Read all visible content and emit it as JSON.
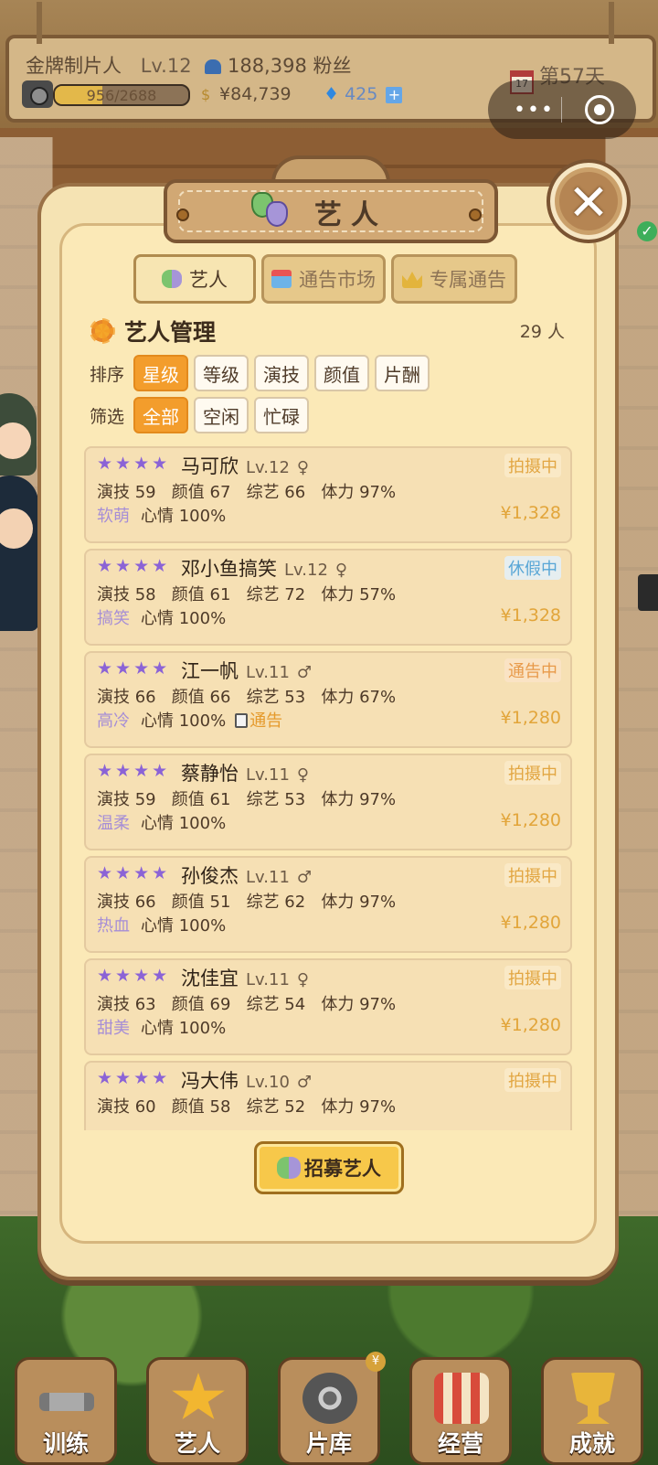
{
  "hud": {
    "title": "金牌制片人",
    "level": "Lv.12",
    "fans": "188,398 粉丝",
    "xp_text": "956/2688",
    "xp_fraction": 0.356,
    "money": "¥84,739",
    "gems": "425",
    "day": "第57天",
    "calendar_day": "17"
  },
  "panel": {
    "title": "艺人",
    "tabs": [
      {
        "label": "艺人",
        "icon": "masks-icon"
      },
      {
        "label": "通告市场",
        "icon": "market-icon"
      },
      {
        "label": "专属通告",
        "icon": "crown-icon"
      }
    ],
    "section_title": "艺人管理",
    "count": "29 人",
    "sort_label": "排序",
    "sort_options": [
      "星级",
      "等级",
      "演技",
      "颜值",
      "片酬"
    ],
    "filter_label": "筛选",
    "filter_options": [
      "全部",
      "空闲",
      "忙碌"
    ],
    "recruit_label": "招募艺人"
  },
  "artists": [
    {
      "stars": "★★★★",
      "name": "马可欣",
      "level": "Lv.12",
      "gender": "♀",
      "status": "拍摄中",
      "stats": "演技 59   颜值 67   综艺 66   体力 97%",
      "trait": "软萌",
      "mood": "心情 100%",
      "tag": "",
      "pay": "¥1,328"
    },
    {
      "stars": "★★★★",
      "name": "邓小鱼搞笑",
      "level": "Lv.12",
      "gender": "♀",
      "status": "休假中",
      "stats": "演技 58   颜值 61   综艺 72   体力 57%",
      "trait": "搞笑",
      "mood": "心情 100%",
      "tag": "",
      "pay": "¥1,328"
    },
    {
      "stars": "★★★★",
      "name": "江一帆",
      "level": "Lv.11",
      "gender": "♂",
      "status": "通告中",
      "stats": "演技 66   颜值 66   综艺 53   体力 67%",
      "trait": "高冷",
      "mood": "心情 100%",
      "tag": "通告",
      "pay": "¥1,280"
    },
    {
      "stars": "★★★★",
      "name": "蔡静怡",
      "level": "Lv.11",
      "gender": "♀",
      "status": "拍摄中",
      "stats": "演技 59   颜值 61   综艺 53   体力 97%",
      "trait": "温柔",
      "mood": "心情 100%",
      "tag": "",
      "pay": "¥1,280"
    },
    {
      "stars": "★★★★",
      "name": "孙俊杰",
      "level": "Lv.11",
      "gender": "♂",
      "status": "拍摄中",
      "stats": "演技 66   颜值 51   综艺 62   体力 97%",
      "trait": "热血",
      "mood": "心情 100%",
      "tag": "",
      "pay": "¥1,280"
    },
    {
      "stars": "★★★★",
      "name": "沈佳宜",
      "level": "Lv.11",
      "gender": "♀",
      "status": "拍摄中",
      "stats": "演技 63   颜值 69   综艺 54   体力 97%",
      "trait": "甜美",
      "mood": "心情 100%",
      "tag": "",
      "pay": "¥1,280"
    },
    {
      "stars": "★★★★",
      "name": "冯大伟",
      "level": "Lv.10",
      "gender": "♂",
      "status": "拍摄中",
      "stats": "演技 60   颜值 58   综艺 52   体力 97%",
      "trait": "",
      "mood": "",
      "tag": "",
      "pay": ""
    }
  ],
  "nav": [
    {
      "label": "训练",
      "icon": "dumbbell-icon"
    },
    {
      "label": "艺人",
      "icon": "star-icon"
    },
    {
      "label": "片库",
      "icon": "film-reel-icon"
    },
    {
      "label": "经营",
      "icon": "shop-icon"
    },
    {
      "label": "成就",
      "icon": "trophy-icon"
    }
  ],
  "capsule": {
    "dots": "•••"
  },
  "colors": {
    "accent": "#f39d2c",
    "star": "#8b63d6",
    "pay": "#e2a53a"
  }
}
